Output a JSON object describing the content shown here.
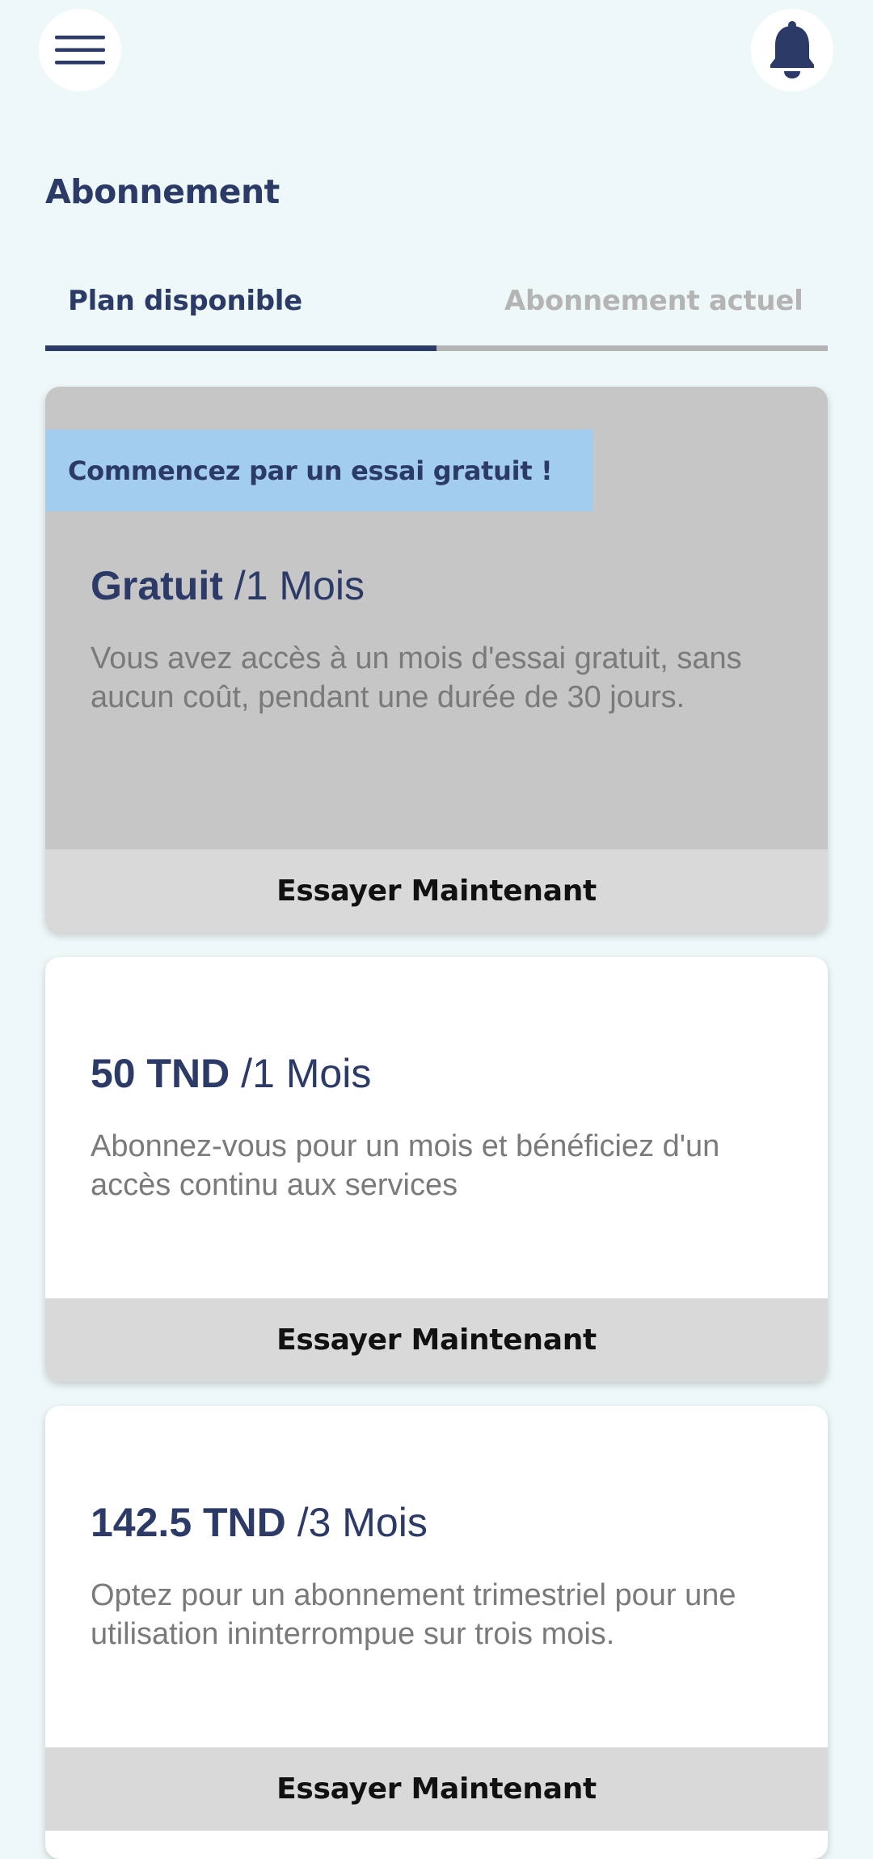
{
  "page_title": "Abonnement",
  "icons": {
    "menu": "hamburger-menu-icon",
    "notifications": "bell-icon"
  },
  "colors": {
    "background": "#eff8f9",
    "primary": "#2b3a67",
    "promo_banner": "#a2cdee",
    "free_card": "#c6c6c6",
    "action_bar": "#d9d9d9"
  },
  "tabs": [
    {
      "label": "Plan disponible",
      "active": true
    },
    {
      "label": "Abonnement actuel",
      "active": false
    }
  ],
  "plans": [
    {
      "banner": "Commencez par un essai gratuit !",
      "price": "Gratuit",
      "period": "/1 Mois",
      "description": "Vous avez accès à un mois d'essai gratuit, sans aucun coût, pendant une durée de 30 jours.",
      "action": "Essayer Maintenant"
    },
    {
      "price": "50 TND",
      "period": "/1 Mois",
      "description": "Abonnez-vous pour un mois et bénéficiez d'un accès continu aux services",
      "action": "Essayer Maintenant"
    },
    {
      "price": "142.5 TND",
      "period": "/3 Mois",
      "description": "Optez pour un abonnement trimestriel pour une utilisation ininterrompue sur trois mois.",
      "action": "Essayer Maintenant"
    }
  ]
}
